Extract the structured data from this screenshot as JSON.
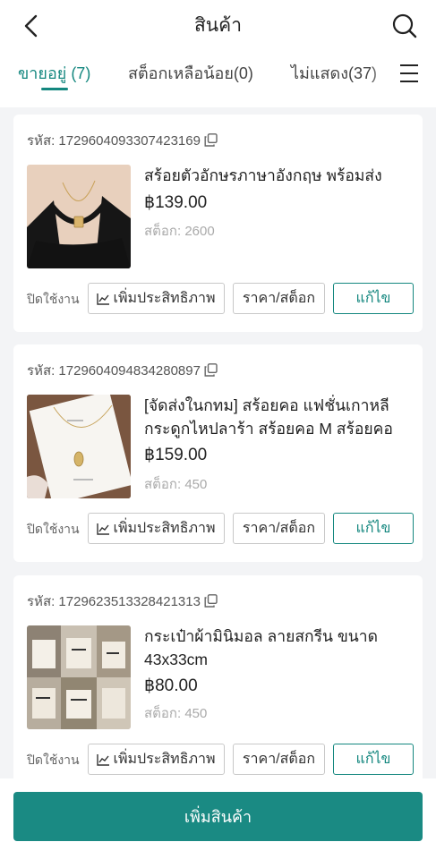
{
  "header": {
    "title": "สินค้า"
  },
  "tabs": [
    {
      "label": "ขายอยู่ (7)",
      "active": true
    },
    {
      "label": "สต็อกเหลือน้อย(0)",
      "active": false
    },
    {
      "label": "ไม่แสดง(37)",
      "active": false
    }
  ],
  "products": [
    {
      "sku": "รหัส: 1729604093307423169",
      "name": "สร้อยตัวอักษรภาษาอังกฤษ พร้อมส่ง",
      "price": "฿139.00",
      "stock": "สต็อก: 2600",
      "image": "necklace-black-top"
    },
    {
      "sku": "รหัส: 1729604094834280897",
      "name": "[จัดส่งในกทม] สร้อยคอ แฟชั่นเกาหลี กระดูกไหปลาร้า สร้อยคอ M สร้อยคอ",
      "price": "฿159.00",
      "stock": "สต็อก: 450",
      "image": "necklace-card"
    },
    {
      "sku": "รหัส: 1729623513328421313",
      "name": "กระเป๋าผ้ามินิมอล  ลายสกรีน ขนาด 43x33cm",
      "price": "฿80.00",
      "stock": "สต็อก: 450",
      "image": "tote-bags-collage"
    }
  ],
  "actions": {
    "disable_label": "ปิดใช้งาน",
    "boost_label": "เพิ่มประสิทธิภาพ",
    "price_stock_label": "ราคา/สต็อก",
    "edit_label": "แก้ไข"
  },
  "bottom": {
    "add_product_label": "เพิ่มสินค้า"
  },
  "colors": {
    "accent": "#14877f",
    "add_button": "#1a8a83"
  }
}
